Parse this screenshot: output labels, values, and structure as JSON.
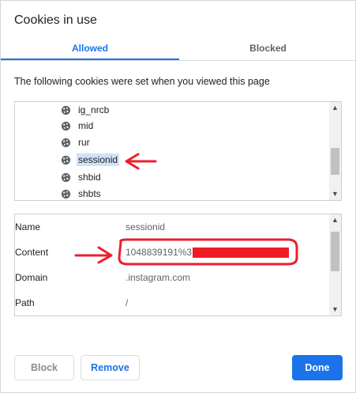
{
  "dialog": {
    "title": "Cookies in use"
  },
  "tabs": [
    {
      "label": "Allowed",
      "active": true
    },
    {
      "label": "Blocked",
      "active": false
    }
  ],
  "description": "The following cookies were set when you viewed this page",
  "cookies": [
    {
      "name": "ig_nrcb",
      "selected": false
    },
    {
      "name": "mid",
      "selected": false
    },
    {
      "name": "rur",
      "selected": false
    },
    {
      "name": "sessionid",
      "selected": true
    },
    {
      "name": "shbid",
      "selected": false
    },
    {
      "name": "shbts",
      "selected": false
    }
  ],
  "details": {
    "name_label": "Name",
    "name_value": "sessionid",
    "content_label": "Content",
    "content_value": "1048839191%3",
    "domain_label": "Domain",
    "domain_value": ".instagram.com",
    "path_label": "Path",
    "path_value": "/"
  },
  "buttons": {
    "block": "Block",
    "remove": "Remove",
    "done": "Done"
  },
  "icons": {
    "cookie": "cookie-icon",
    "scroll_up": "chevron-up-icon",
    "scroll_down": "chevron-down-icon"
  },
  "colors": {
    "accent": "#1a73e8",
    "selection": "#cfe2f8",
    "annotation": "#e8202e",
    "redaction": "#ee1c25"
  }
}
